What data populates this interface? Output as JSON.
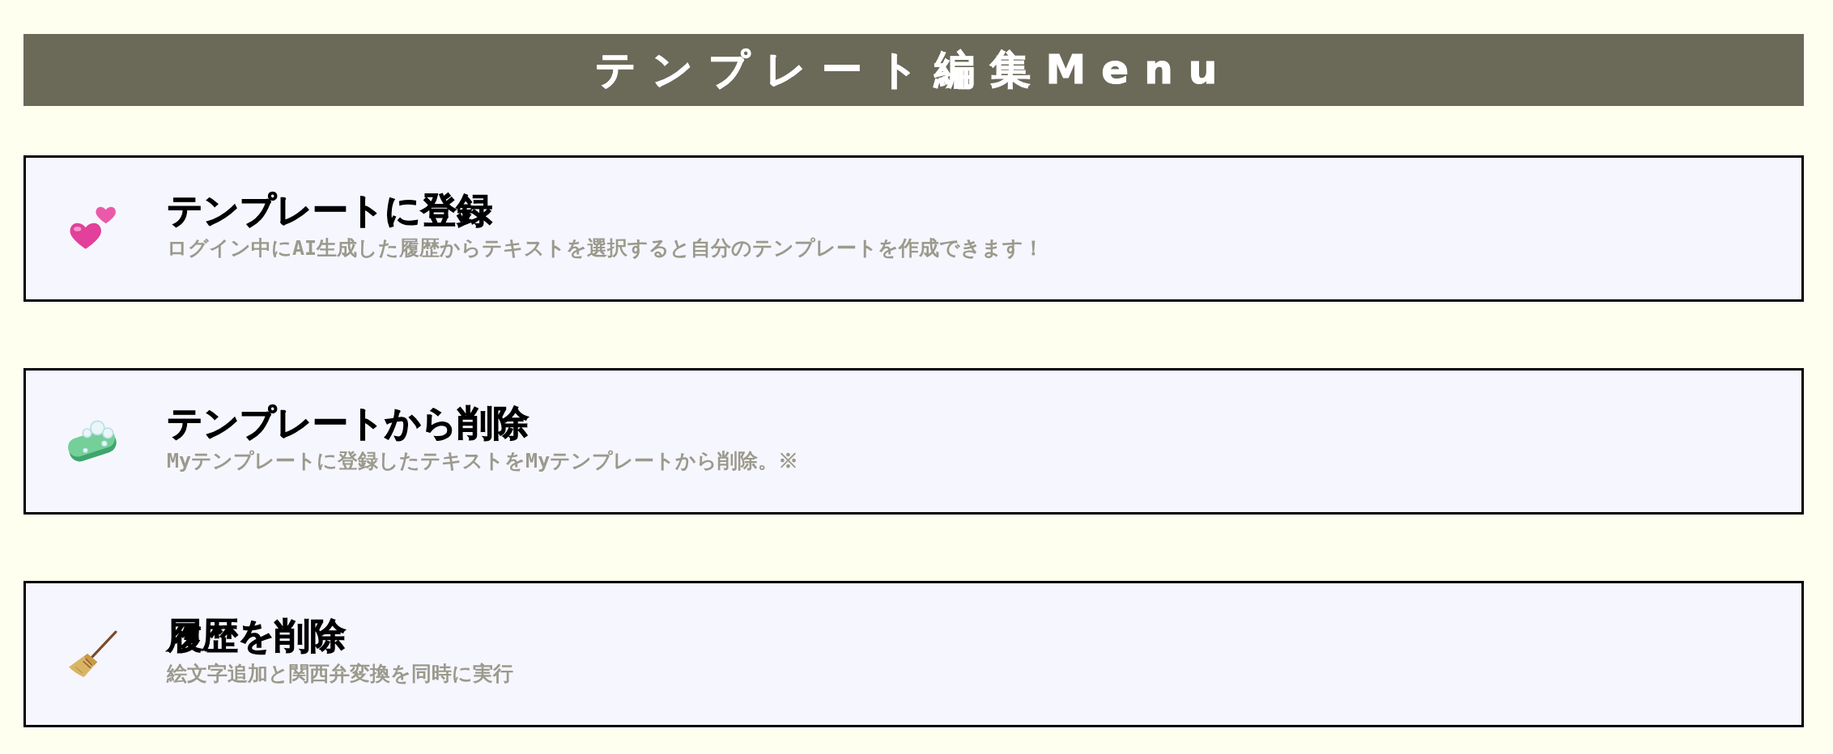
{
  "header": {
    "title": "テンプレート編集Menu"
  },
  "menu_items": [
    {
      "kind": "hearts",
      "title": "テンプレートに登録",
      "description": "ログイン中にAI生成した履歴からテキストを選択すると自分のテンプレートを作成できます！"
    },
    {
      "kind": "soap",
      "title": "テンプレートから削除",
      "description": "Myテンプレートに登録したテキストをMyテンプレートから削除。※"
    },
    {
      "kind": "broom",
      "title": "履歴を削除",
      "description": "絵文字追加と関西弁変換を同時に実行"
    }
  ]
}
